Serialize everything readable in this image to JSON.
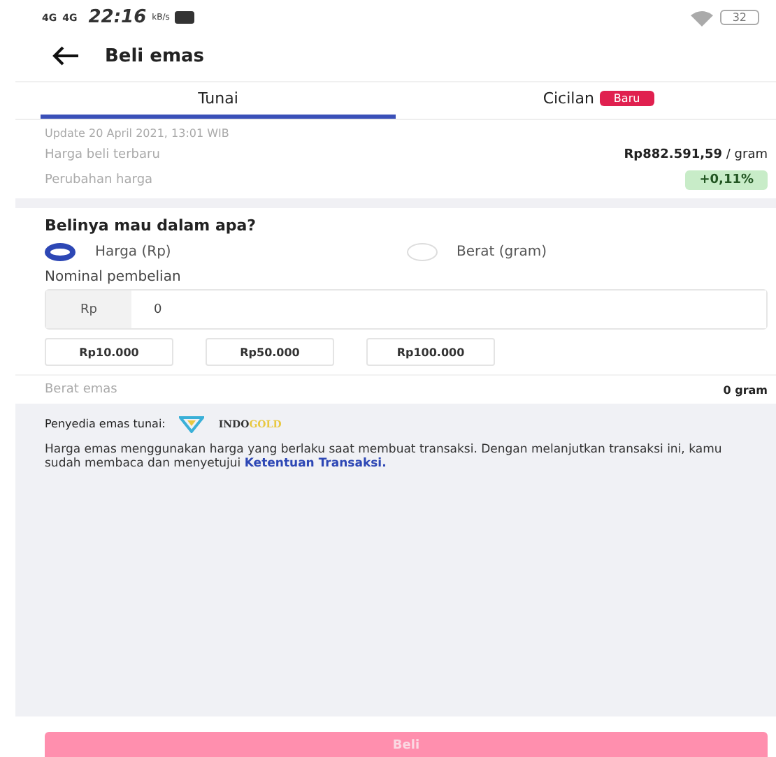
{
  "status_bar": {
    "network_1": "4G",
    "network_2": "4G",
    "time": "22:16",
    "speed": "kB/s",
    "battery": "32"
  },
  "header": {
    "title": "Beli emas"
  },
  "tabs": [
    {
      "label": "Tunai",
      "selected": true
    },
    {
      "label": "Cicilan",
      "badge": "Baru",
      "selected": false
    }
  ],
  "price_info": {
    "updated": "Update 20 April 2021, 13:01 WIB",
    "price_label": "Harga beli terbaru",
    "price": "Rp882.591,59",
    "price_unit": "/ gram",
    "change_label": "Perubahan harga",
    "change": "+0,11%"
  },
  "purchase": {
    "question": "Belinya mau dalam apa?",
    "options": [
      {
        "label": "Harga (Rp)",
        "selected": true
      },
      {
        "label": "Berat (gram)",
        "selected": false
      }
    ],
    "amount_label": "Nominal pembelian",
    "prefix": "Rp",
    "value": "0",
    "presets": [
      "Rp10.000",
      "Rp50.000",
      "Rp100.000"
    ],
    "weight_label": "Berat emas",
    "weight": "0 gram"
  },
  "provider": {
    "label": "Penyedia emas tunai:",
    "logo_1": "INDO",
    "logo_2": "GOLD"
  },
  "disclaimer": {
    "text": "Harga emas menggunakan harga yang berlaku saat membuat transaksi. Dengan melanjutkan transaksi ini, kamu sudah membaca dan menyetujui",
    "link": "Ketentuan Transaksi."
  },
  "buy_button": {
    "label": "Beli",
    "disabled": true
  }
}
